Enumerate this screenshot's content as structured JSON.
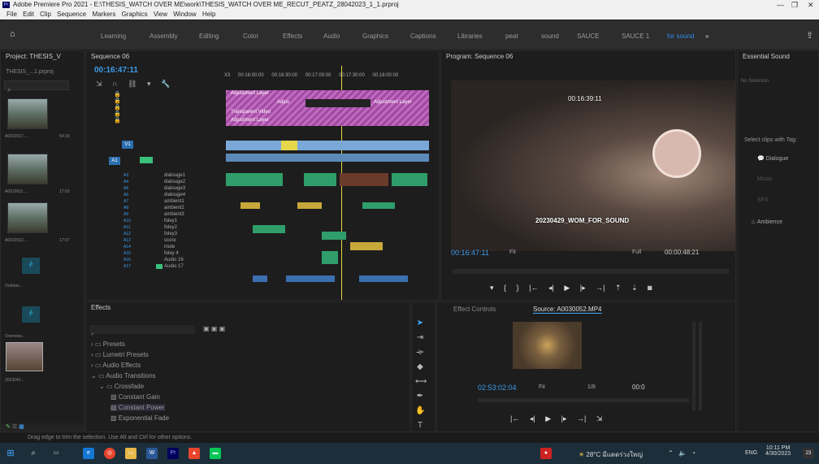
{
  "window": {
    "title": "Adobe Premiere Pro 2021 - E:\\THESIS_WATCH OVER ME\\work\\THESIS_WATCH OVER ME_RECUT_PEATZ_28042023_1_1.prproj",
    "controls": [
      "—",
      "❐",
      "✕"
    ]
  },
  "menu": [
    "File",
    "Edit",
    "Clip",
    "Sequence",
    "Markers",
    "Graphics",
    "View",
    "Window",
    "Help"
  ],
  "workspaces": [
    "Learning",
    "Assembly",
    "Editing",
    "Color",
    "Effects",
    "Audio",
    "Graphics",
    "Captions",
    "Libraries",
    "peat",
    "sound",
    "SAUCE",
    "SAUCE 1",
    "for sound"
  ],
  "workspace_more": "»",
  "project": {
    "title": "Project: THESIS_V",
    "file": "THESIS_...1.prproj",
    "items": [
      {
        "name": "A0010017....",
        "dur": "54:18"
      },
      {
        "name": "A0010011....",
        "dur": "17:03"
      },
      {
        "name": "A0010012....",
        "dur": "17:07"
      },
      {
        "name": "Outdoor...",
        "dur": "36:00:51"
      },
      {
        "name": "Overview...",
        "dur": "5:21:160"
      },
      {
        "name": "2023042...",
        "dur": "30:33:51"
      }
    ]
  },
  "timeline": {
    "title": "Sequence 06",
    "timecode": "00:16:47:11",
    "ruler": [
      "00:16:00:00",
      "00:16:30:00",
      "00:17:00:00",
      "00:17:30:00",
      "00:18:00:00"
    ],
    "ruler_prefix": "X3",
    "video_clip_labels": [
      "Adjustment Layer",
      "Adjus",
      "Adjustment Layer",
      "Transparent Video",
      "Adjustment Layer"
    ],
    "video_tracks": [
      "V1"
    ],
    "audio_tracks": [
      {
        "id": "A1",
        "name": ""
      },
      {
        "id": "A3",
        "name": "dialouge1"
      },
      {
        "id": "A4",
        "name": "dialouge2"
      },
      {
        "id": "A5",
        "name": "dialouge3"
      },
      {
        "id": "A6",
        "name": "dialouge4"
      },
      {
        "id": "A7",
        "name": "ambient1"
      },
      {
        "id": "A8",
        "name": "ambient2"
      },
      {
        "id": "A9",
        "name": "ambient3"
      },
      {
        "id": "A10",
        "name": "foley1"
      },
      {
        "id": "A11",
        "name": "foley2"
      },
      {
        "id": "A12",
        "name": "foley3"
      },
      {
        "id": "A13",
        "name": "score"
      },
      {
        "id": "A14",
        "name": "mute"
      },
      {
        "id": "A15",
        "name": "foley 4"
      },
      {
        "id": "A16",
        "name": "Audio 16"
      },
      {
        "id": "A17",
        "name": "Audio 17"
      }
    ]
  },
  "program": {
    "title": "Program: Sequence 06",
    "overlay_timecode": "00:16:39:11",
    "overlay_caption": "20230429_WOM_FOR_SOUND",
    "timecode": "00:16:47:11",
    "fit": "Fit",
    "quality": "Full",
    "duration": "00:00:48:21"
  },
  "essential_sound": {
    "title": "Essential Sound",
    "no_selection": "No Selection",
    "prompt": "Select clips with Tag:",
    "tags": [
      "Dialogue",
      "Music",
      "SFX",
      "Ambience"
    ]
  },
  "effects": {
    "title": "Effects",
    "items": [
      {
        "label": "Presets",
        "level": 0
      },
      {
        "label": "Lumetri Presets",
        "level": 0
      },
      {
        "label": "Audio Effects",
        "level": 0
      },
      {
        "label": "Audio Transitions",
        "level": 0
      },
      {
        "label": "Crossfade",
        "level": 1
      },
      {
        "label": "Constant Gain",
        "level": 2
      },
      {
        "label": "Constant Power",
        "level": 2
      },
      {
        "label": "Exponential Fade",
        "level": 2
      }
    ]
  },
  "source": {
    "tab_effect_controls": "Effect Controls",
    "title": "Source: A0030052.MP4",
    "timecode": "02:53:02:04",
    "fit": "Fit",
    "scale": "1/8",
    "duration": "00:0"
  },
  "status": {
    "message": "Drag edge to trim the selection. Use Alt and Ctrl for other options."
  },
  "taskbar": {
    "weather": "28°C มีแดดร่วงใหญ่",
    "lang": "ENG",
    "time": "10:11 PM",
    "date": "4/30/2023",
    "notif": "23"
  }
}
